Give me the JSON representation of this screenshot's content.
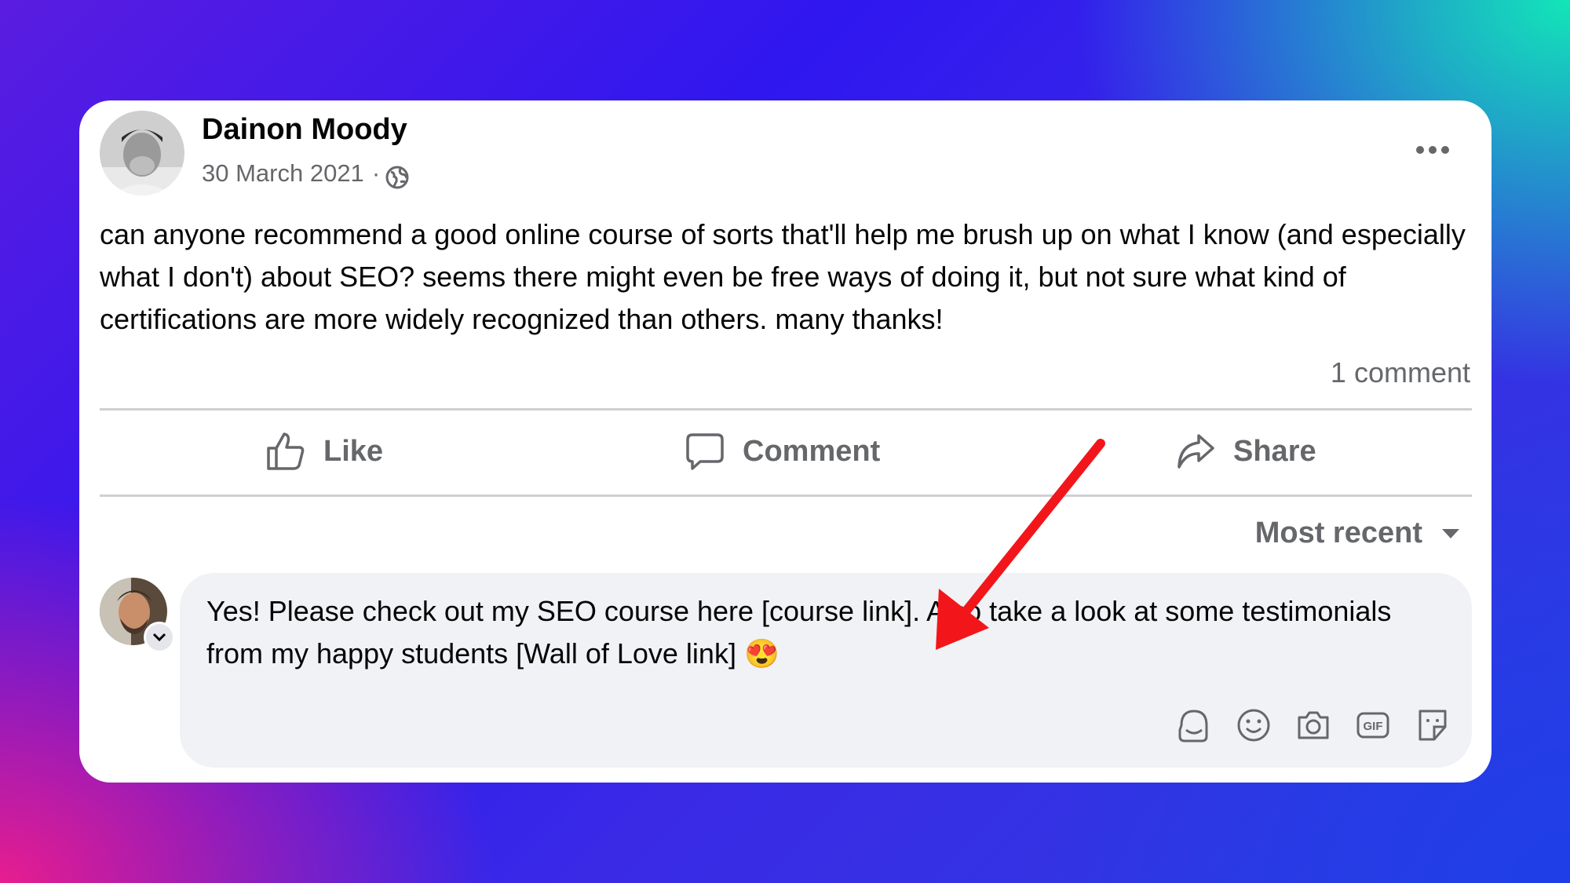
{
  "post": {
    "author": "Dainon Moody",
    "date": "30 March 2021",
    "separator": "·",
    "text": "can anyone recommend a good online course of sorts that'll help me brush up on what I know (and especially what I don't) about SEO? seems there might even be free ways of doing it, but not sure what kind of certifications are more widely recognized than others. many thanks!",
    "comment_count": "1 comment"
  },
  "actions": {
    "like": "Like",
    "comment": "Comment",
    "share": "Share"
  },
  "comments_sort": "Most recent",
  "comment": {
    "text": "Yes! Please check out my SEO course here [course link]. Also take a look at some testimonials from my happy students [Wall of Love link] 😍"
  },
  "icons": {
    "more": "more-options-icon",
    "globe": "globe-icon",
    "like": "thumbs-up-icon",
    "comment": "speech-bubble-icon",
    "share": "share-arrow-icon",
    "sort": "caret-down-icon",
    "tools": [
      "avatar-sticker-icon",
      "emoji-icon",
      "camera-icon",
      "gif-icon",
      "sticker-icon"
    ]
  },
  "colors": {
    "annotation_arrow": "#f2161b",
    "text_secondary": "#65676b",
    "bubble": "#f0f2f5"
  }
}
